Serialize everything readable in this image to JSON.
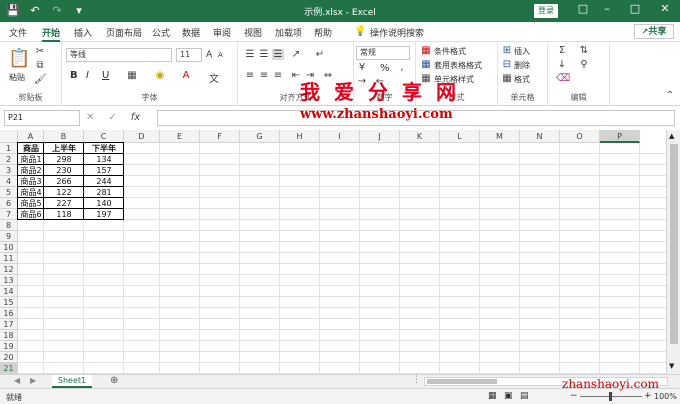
{
  "titlebar": {
    "title": "示例.xlsx - Excel",
    "login": "登录",
    "qat_icons": [
      "save-icon",
      "undo-icon",
      "redo-icon",
      "customize-icon"
    ]
  },
  "tabs": [
    "文件",
    "开始",
    "插入",
    "页面布局",
    "公式",
    "数据",
    "审阅",
    "视图",
    "加载项",
    "帮助"
  ],
  "tell_me": "操作说明搜索",
  "share": "共享",
  "ribbon": {
    "clipboard": {
      "paste": "粘贴",
      "label": "剪贴板"
    },
    "font": {
      "name": "等线",
      "size": "11",
      "label": "字体",
      "bold": "B",
      "italic": "I",
      "underline": "U",
      "grow": "A",
      "shrink": "A"
    },
    "alignment": {
      "label": "对齐方式"
    },
    "number": {
      "format": "常规",
      "label": "数字",
      "percent": "%"
    },
    "styles": {
      "conditional": "条件格式",
      "table": "套用表格格式",
      "cell": "单元格样式",
      "label": "样式"
    },
    "cells": {
      "insert": "插入",
      "delete": "删除",
      "format": "格式",
      "label": "单元格"
    },
    "editing": {
      "label": "编辑"
    }
  },
  "formula_bar": {
    "name_box": "P21",
    "fx": "fx",
    "value": ""
  },
  "columns": [
    "A",
    "B",
    "C",
    "D",
    "E",
    "F",
    "G",
    "H",
    "I",
    "J",
    "K",
    "L",
    "M",
    "N",
    "O",
    "P"
  ],
  "rows": [
    "1",
    "2",
    "3",
    "4",
    "5",
    "6",
    "7",
    "8",
    "9",
    "10",
    "11",
    "12",
    "13",
    "14",
    "15",
    "16",
    "17",
    "18",
    "19",
    "20",
    "21"
  ],
  "table": {
    "headers": [
      "商品",
      "上半年",
      "下半年"
    ],
    "rows": [
      [
        "商品1",
        "298",
        "134"
      ],
      [
        "商品2",
        "230",
        "157"
      ],
      [
        "商品3",
        "266",
        "244"
      ],
      [
        "商品4",
        "122",
        "281"
      ],
      [
        "商品5",
        "227",
        "140"
      ],
      [
        "商品6",
        "118",
        "197"
      ]
    ]
  },
  "sheet_tab": "Sheet1",
  "status": {
    "ready": "就绪",
    "zoom": "100%",
    "zoom_minus": "−",
    "zoom_plus": "+"
  },
  "watermark": {
    "big": "我爱分享网",
    "url": "www.zhanshaoyi.com",
    "corner": "zhanshaoyi.com"
  },
  "colors": {
    "accent": "#217346",
    "watermark": "#e3001b"
  }
}
